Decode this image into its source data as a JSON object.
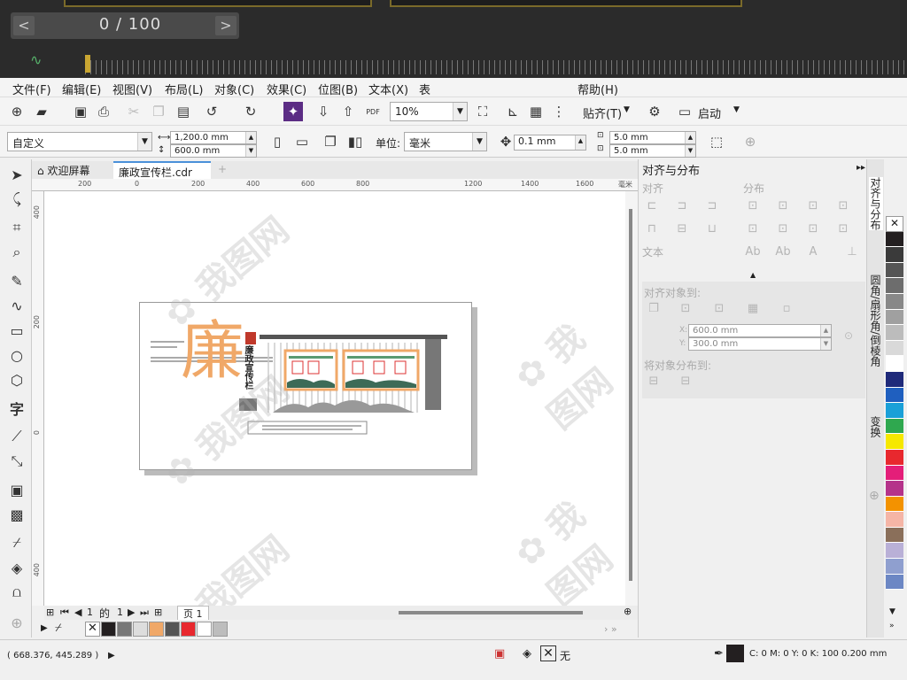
{
  "player": {
    "counter": "0 / 100",
    "prev": "<",
    "next": ">"
  },
  "menu": [
    "文件(F)",
    "编辑(E)",
    "视图(V)",
    "布局(L)",
    "对象(C)",
    "效果(C)",
    "位图(B)",
    "文本(X)",
    "表",
    "帮助(H)"
  ],
  "toolbar1": {
    "zoom": "10%",
    "snap_label": "贴齐(T)",
    "launch_label": "启动"
  },
  "toolbar2": {
    "preset": "自定义",
    "width": "1,200.0 mm",
    "height": "600.0 mm",
    "unit_label": "单位:",
    "unit": "毫米",
    "nudge": "0.1 mm",
    "dup_x": "5.0 mm",
    "dup_y": "5.0 mm"
  },
  "doc_tabs": {
    "home": "欢迎屏幕",
    "file": "廉政宣传栏.cdr"
  },
  "ruler_h": [
    "200",
    "0",
    "200",
    "400",
    "600",
    "800",
    "1200",
    "1400",
    "1600",
    "毫米"
  ],
  "ruler_v": [
    "400",
    "200",
    "0",
    "400"
  ],
  "artwork": {
    "big_char": "廉",
    "vertical_title": "廉政宣传栏"
  },
  "page_nav": {
    "current": "1",
    "of": "的",
    "total": "1",
    "page_tab": "页 1"
  },
  "status": {
    "coords": "( 668.376, 445.289 )",
    "fill_none": "无",
    "color_info": "C: 0 M: 0 Y: 0 K: 100  0.200 mm"
  },
  "docker": {
    "title": "对齐与分布",
    "align": "对齐",
    "distribute": "分布",
    "text": "文本",
    "align_to": "对齐对象到:",
    "x": "600.0 mm",
    "y": "300.0 mm",
    "x_label": "X:",
    "y_label": "Y:",
    "distribute_to": "将对象分布到:"
  },
  "docker_tabs": [
    "对齐与分布",
    "圆角/扇形角/倒棱角",
    "变换"
  ],
  "colors": {
    "palette": [
      "#ffffff",
      "#231f20",
      "#3a3a3a",
      "#555555",
      "#6d6d6d",
      "#888888",
      "#a0a0a0",
      "#bcbcbc",
      "#d9d9d9",
      "#ffffff",
      "#1f2a7a",
      "#1f5fbf",
      "#1aa0d8",
      "#2fa84f",
      "#f6e800",
      "#e8282e",
      "#e41e79",
      "#b5338a",
      "#f39200",
      "#f5b5a6",
      "#8a6f5a",
      "#b9b0d7",
      "#8f9fcf",
      "#6c87c4"
    ],
    "doc_palette": [
      "#231f20",
      "#777777",
      "#dddddd",
      "#f0a868",
      "#555555",
      "#e8282e",
      "#ffffff",
      "#bdbdbd"
    ],
    "accent_orange": "#f0a868"
  }
}
